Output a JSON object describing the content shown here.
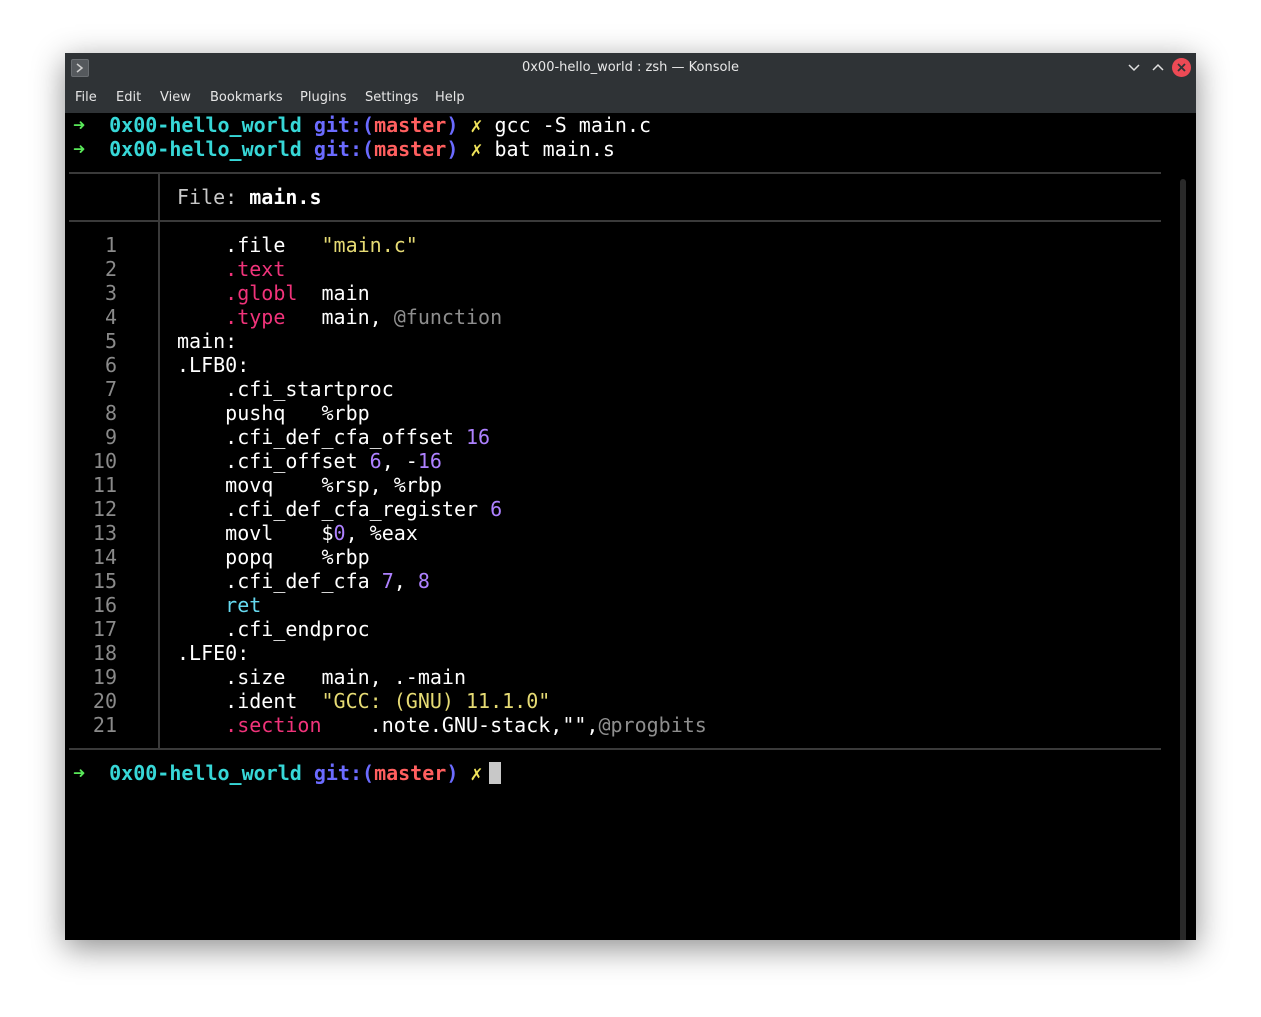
{
  "window": {
    "title": "0x00-hello_world : zsh — Konsole"
  },
  "menu": [
    "File",
    "Edit",
    "View",
    "Bookmarks",
    "Plugins",
    "Settings",
    "Help"
  ],
  "prompt": {
    "arrow": "➜",
    "dir": "0x00-hello_world",
    "git_prefix": "git:(",
    "branch": "master",
    "git_suffix": ")",
    "dirty": "✗"
  },
  "commands": [
    "gcc -S main.c",
    "bat main.s"
  ],
  "file_header": {
    "label": "File: ",
    "name": "main.s"
  },
  "code_lines": [
    [
      {
        "t": "    .file   ",
        "c": ""
      },
      {
        "t": "\"main.c\"",
        "c": "str"
      }
    ],
    [
      {
        "t": "    ",
        "c": ""
      },
      {
        "t": ".text",
        "c": "pink"
      }
    ],
    [
      {
        "t": "    ",
        "c": ""
      },
      {
        "t": ".globl",
        "c": "pink"
      },
      {
        "t": "  main",
        "c": ""
      }
    ],
    [
      {
        "t": "    ",
        "c": ""
      },
      {
        "t": ".type",
        "c": "pink"
      },
      {
        "t": "   main, ",
        "c": ""
      },
      {
        "t": "@function",
        "c": "gray"
      }
    ],
    [
      {
        "t": "main:",
        "c": ""
      }
    ],
    [
      {
        "t": ".LFB0:",
        "c": ""
      }
    ],
    [
      {
        "t": "    .cfi_startproc",
        "c": ""
      }
    ],
    [
      {
        "t": "    pushq   %rbp",
        "c": ""
      }
    ],
    [
      {
        "t": "    .cfi_def_cfa_offset ",
        "c": ""
      },
      {
        "t": "16",
        "c": "num"
      }
    ],
    [
      {
        "t": "    .cfi_offset ",
        "c": ""
      },
      {
        "t": "6",
        "c": "num"
      },
      {
        "t": ", -",
        "c": ""
      },
      {
        "t": "16",
        "c": "num"
      }
    ],
    [
      {
        "t": "    movq    %rsp, %rbp",
        "c": ""
      }
    ],
    [
      {
        "t": "    .cfi_def_cfa_register ",
        "c": ""
      },
      {
        "t": "6",
        "c": "num"
      }
    ],
    [
      {
        "t": "    movl    $",
        "c": ""
      },
      {
        "t": "0",
        "c": "num"
      },
      {
        "t": ", %eax",
        "c": ""
      }
    ],
    [
      {
        "t": "    popq    %rbp",
        "c": ""
      }
    ],
    [
      {
        "t": "    .cfi_def_cfa ",
        "c": ""
      },
      {
        "t": "7",
        "c": "num"
      },
      {
        "t": ", ",
        "c": ""
      },
      {
        "t": "8",
        "c": "num"
      }
    ],
    [
      {
        "t": "    ",
        "c": ""
      },
      {
        "t": "ret",
        "c": "kw"
      }
    ],
    [
      {
        "t": "    .cfi_endproc",
        "c": ""
      }
    ],
    [
      {
        "t": ".LFE0:",
        "c": ""
      }
    ],
    [
      {
        "t": "    .size   main, .-main",
        "c": ""
      }
    ],
    [
      {
        "t": "    .ident  ",
        "c": ""
      },
      {
        "t": "\"GCC: (GNU) 11.1.0\"",
        "c": "str"
      }
    ],
    [
      {
        "t": "    ",
        "c": ""
      },
      {
        "t": ".section",
        "c": "pink"
      },
      {
        "t": "    .note.GNU-stack,\"\",",
        "c": ""
      },
      {
        "t": "@progbits",
        "c": "gray"
      }
    ]
  ]
}
